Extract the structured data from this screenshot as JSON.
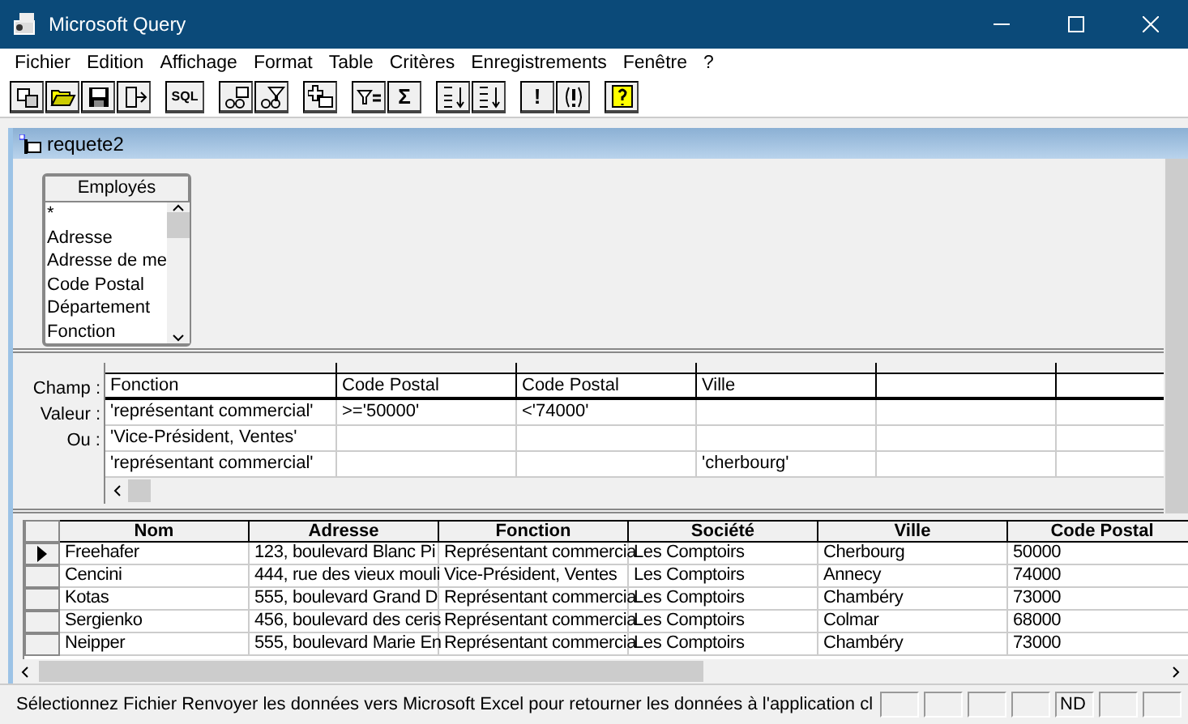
{
  "window": {
    "title": "Microsoft Query"
  },
  "menu": [
    "Fichier",
    "Edition",
    "Affichage",
    "Format",
    "Table",
    "Critères",
    "Enregistrements",
    "Fenêtre",
    "?"
  ],
  "toolbar": [
    [
      {
        "kind": "icon"
      },
      {
        "kind": "icon"
      },
      {
        "kind": "icon"
      },
      {
        "kind": "icon"
      }
    ],
    [
      {
        "kind": "text",
        "label": "SQL"
      }
    ],
    [
      {
        "kind": "icon"
      },
      {
        "kind": "icon"
      }
    ],
    [
      {
        "kind": "icon"
      }
    ],
    [
      {
        "kind": "icon"
      },
      {
        "kind": "text",
        "label": "Σ"
      }
    ],
    [
      {
        "kind": "icon"
      },
      {
        "kind": "icon"
      }
    ],
    [
      {
        "kind": "text",
        "label": "!"
      },
      {
        "kind": "icon"
      }
    ],
    [
      {
        "kind": "icon"
      }
    ]
  ],
  "query_window": {
    "title": "requete2",
    "table": {
      "title": "Employés",
      "fields": [
        "*",
        "Adresse",
        "Adresse de me",
        "Code Postal",
        "Département",
        "Fonction"
      ]
    },
    "criteria": {
      "row_labels": [
        "Champ :",
        "Valeur :",
        "Ou :"
      ],
      "fields": [
        "Fonction",
        "Code Postal",
        "Code Postal",
        "Ville"
      ],
      "rows": [
        [
          "'représentant commercial'",
          ">='50000'",
          "<'74000'",
          null
        ],
        [
          "'Vice-Président, Ventes'",
          null,
          null,
          null
        ],
        [
          "'représentant commercial'",
          null,
          null,
          "'cherbourg'"
        ]
      ]
    },
    "results": {
      "columns": [
        "Nom",
        "Adresse",
        "Fonction",
        "Société",
        "Ville",
        "Code Postal"
      ],
      "rows": [
        {
          "current": true,
          "cells": [
            "Freehafer",
            "123, boulevard Blanc Pi",
            "Représentant commercia",
            "Les Comptoirs",
            "Cherbourg",
            "50000"
          ]
        },
        {
          "current": false,
          "cells": [
            "Cencini",
            "444, rue des vieux mouli",
            "Vice-Président, Ventes",
            "Les Comptoirs",
            "Annecy",
            "74000"
          ]
        },
        {
          "current": false,
          "cells": [
            "Kotas",
            "555, boulevard Grand D",
            "Représentant commercia",
            "Les Comptoirs",
            "Chambéry",
            "73000"
          ]
        },
        {
          "current": false,
          "cells": [
            "Sergienko",
            "456, boulevard des ceris",
            "Représentant commercia",
            "Les Comptoirs",
            "Colmar",
            "68000"
          ]
        },
        {
          "current": false,
          "cells": [
            "Neipper",
            "555, boulevard Marie En",
            "Représentant commercia",
            "Les Comptoirs",
            "Chambéry",
            "73000"
          ]
        }
      ]
    }
  },
  "status_bar": {
    "message": "Sélectionnez Fichier Renvoyer les données vers Microsoft Excel pour retourner les données à l'application cl",
    "indicator": "ND"
  }
}
